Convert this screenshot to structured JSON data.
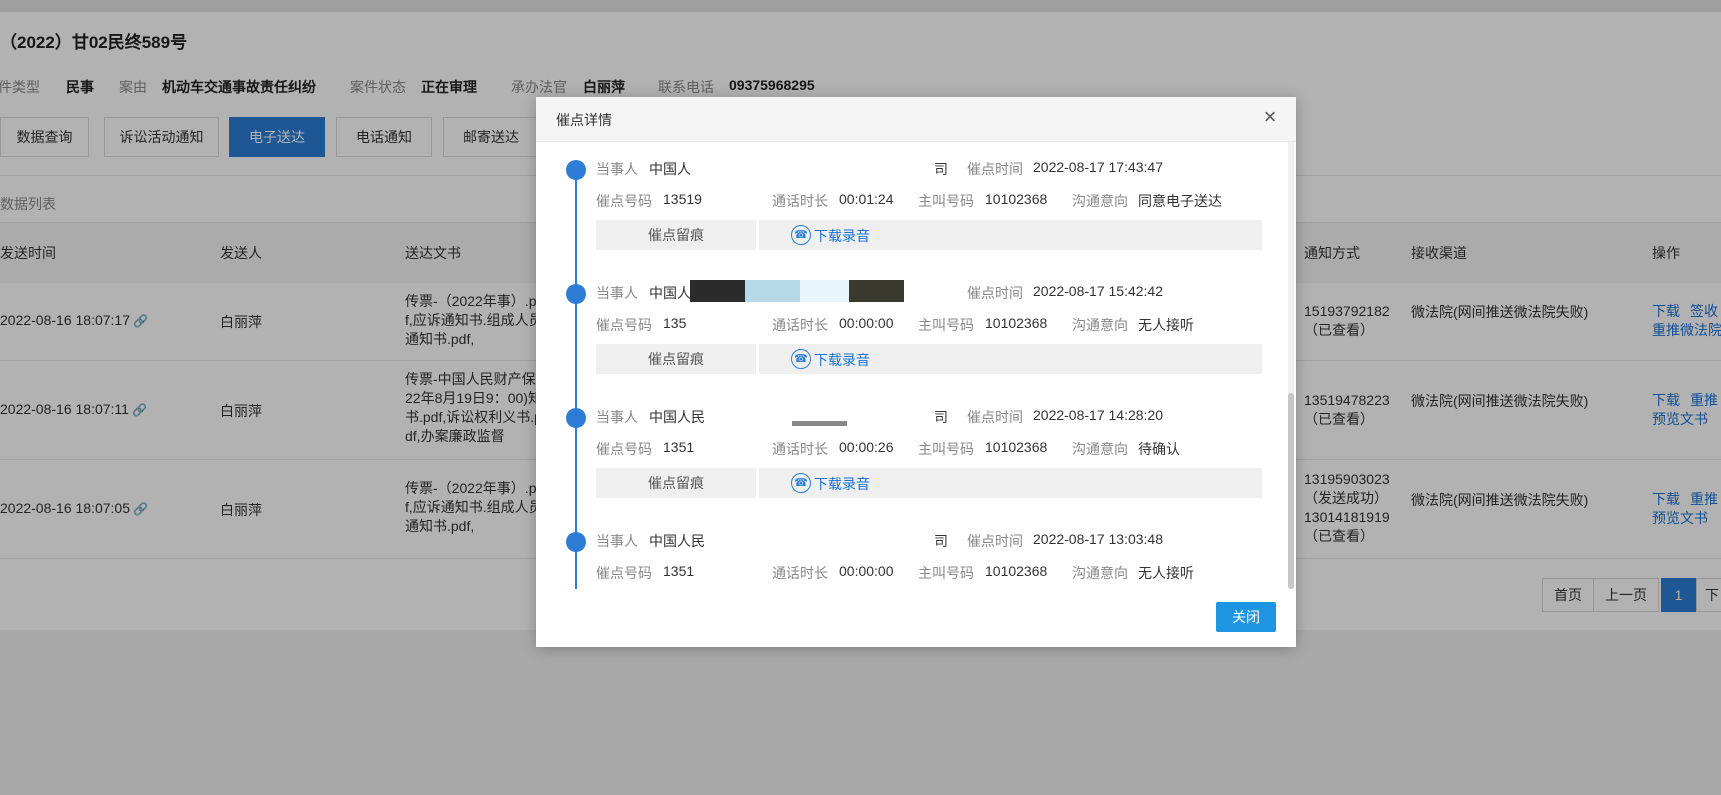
{
  "case": {
    "title": "（2022）甘02民终589号",
    "fields": [
      {
        "label": "案件类型",
        "value": "民事"
      },
      {
        "label": "案由",
        "value": "机动车交通事故责任纠纷"
      },
      {
        "label": "案件状态",
        "value": "正在审理"
      },
      {
        "label": "承办法官",
        "value": "白丽萍"
      },
      {
        "label": "联系电话",
        "value": "09375968295"
      }
    ]
  },
  "tabs": [
    {
      "label": "数据查询",
      "active": false
    },
    {
      "label": "诉讼活动通知",
      "active": false
    },
    {
      "label": "电子送达",
      "active": true
    },
    {
      "label": "电话通知",
      "active": false
    },
    {
      "label": "邮寄送达",
      "active": false
    }
  ],
  "list": {
    "title": "数据列表",
    "headers": {
      "send_time": "发送时间",
      "sender": "发送人",
      "document": "送达文书",
      "notify_method": "通知方式",
      "channel": "接收渠道",
      "actions": "操作"
    },
    "rows": [
      {
        "time": "2022-08-16 18:07:17",
        "sender": "白丽萍",
        "document": "传票-（2022年事）.pdf,应诉通知书.组成人员通知书.pdf,",
        "notify": [
          "15193792182",
          "（已查看）"
        ],
        "channel": "微法院(网间推送微法院失败)",
        "actions": [
          "下载",
          "签收",
          "重推微法院"
        ]
      },
      {
        "time": "2022-08-16 18:07:11",
        "sender": "白丽萍",
        "document": "传票-中国人民财产保022年8月19日9：00)知书.pdf,诉讼权利义书.pdf,办案廉政监督",
        "notify": [
          "13519478223",
          "（已查看）"
        ],
        "channel": "微法院(网间推送微法院失败)",
        "actions": [
          "下载",
          "重推",
          "预览文书"
        ]
      },
      {
        "time": "2022-08-16 18:07:05",
        "sender": "白丽萍",
        "document": "传票-（2022年事）.pdf,应诉通知书.组成人员通知书.pdf,",
        "notify": [
          "13195903023",
          "（发送成功）",
          "13014181919",
          "（已查看）"
        ],
        "channel": "微法院(网间推送微法院失败)",
        "actions": [
          "下载",
          "重推",
          "预览文书"
        ]
      }
    ]
  },
  "pager": {
    "first": "首页",
    "prev": "上一页",
    "current": "1",
    "next": "下"
  },
  "modal": {
    "title": "催点详情",
    "close_label": "关闭",
    "labels": {
      "party": "当事人",
      "time": "催点时间",
      "number": "催点号码",
      "duration": "通话时长",
      "caller": "主叫号码",
      "intent": "沟通意向",
      "trace": "催点留痕",
      "download": "下载录音"
    },
    "entries": [
      {
        "party": "中国人",
        "party_suffix": "司",
        "time": "2022-08-17 17:43:47",
        "number": "13519",
        "duration": "00:01:24",
        "caller": "10102368",
        "intent": "同意电子送达"
      },
      {
        "party": "中国人",
        "party_suffix": "",
        "time": "2022-08-17 15:42:42",
        "number": "135",
        "duration": "00:00:00",
        "caller": "10102368",
        "intent": "无人接听"
      },
      {
        "party": "中国人民",
        "party_suffix": "司",
        "time": "2022-08-17 14:28:20",
        "number": "1351",
        "duration": "00:00:26",
        "caller": "10102368",
        "intent": "待确认"
      },
      {
        "party": "中国人民",
        "party_suffix": "司",
        "time": "2022-08-17 13:03:48",
        "number": "1351",
        "duration": "00:00:00",
        "caller": "10102368",
        "intent": "无人接听"
      }
    ]
  },
  "colors": {
    "primary": "#2d7dd6",
    "link": "#1a73d9",
    "close_button": "#1e96e4"
  },
  "icons": {
    "close": "close-icon",
    "phone": "phone-icon",
    "link": "link-icon"
  }
}
